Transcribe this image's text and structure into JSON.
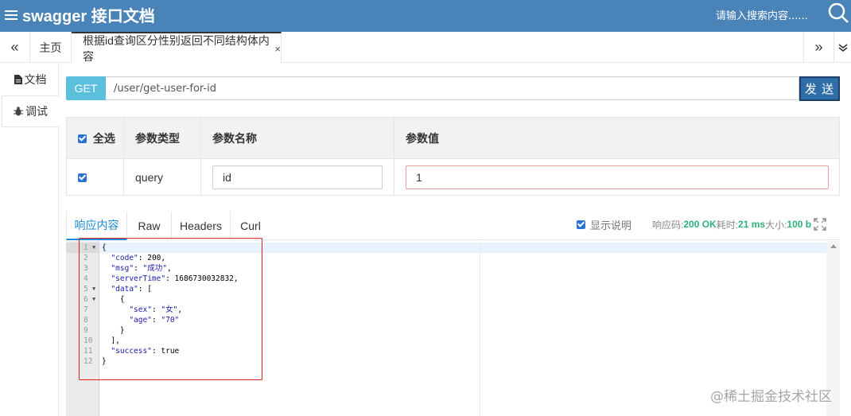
{
  "header": {
    "title": "swagger 接口文档",
    "search_placeholder": "请输入搜索内容......",
    "bg_color": "#4a83b8"
  },
  "tabs": {
    "prev_label": "«",
    "home_label": "主页",
    "active_label": "根据id查询区分性别返回不同结构体内容",
    "close_label": "×",
    "next_label": "»",
    "dropdown_icon": "double-chevron-down-icon"
  },
  "sidebar": {
    "items": [
      {
        "label": "文档",
        "icon": "document-icon"
      },
      {
        "label": "调试",
        "icon": "bug-icon"
      }
    ]
  },
  "request": {
    "method": "GET",
    "url": "/user/get-user-for-id",
    "send_label": "发 送"
  },
  "params": {
    "headers": [
      "全选",
      "参数类型",
      "参数名称",
      "参数值"
    ],
    "rows": [
      {
        "checked": true,
        "type": "query",
        "name": "id",
        "value": "1"
      }
    ]
  },
  "response": {
    "tabs": [
      "响应内容",
      "Raw",
      "Headers",
      "Curl"
    ],
    "active_tab": "响应内容",
    "show_desc_label": "显示说明",
    "status_prefix": "响应码:",
    "status_code": "200 OK",
    "time_prefix": "耗时:",
    "time": "21 ms",
    "size_prefix": "大小:",
    "size": "100 b",
    "line_numbers": [
      "1",
      "2",
      "3",
      "4",
      "5",
      "6",
      "7",
      "8",
      "9",
      "10",
      "11",
      "12"
    ],
    "code_lines": [
      "{",
      "  \"code\": 200,",
      "  \"msg\": \"成功\",",
      "  \"serverTime\": 1686730032832,",
      "  \"data\": [",
      "    {",
      "      \"sex\": \"女\",",
      "      \"age\": \"70\"",
      "    }",
      "  ],",
      "  \"success\": true",
      "}"
    ]
  },
  "watermark": "@稀土掘金技术社区",
  "colors": {
    "get_badge": "#5bc0de",
    "send_button": "#2f6da7",
    "status_green": "#2ab27b",
    "active_tab": "#1e8bd8",
    "highlight_box": "#e02020"
  }
}
